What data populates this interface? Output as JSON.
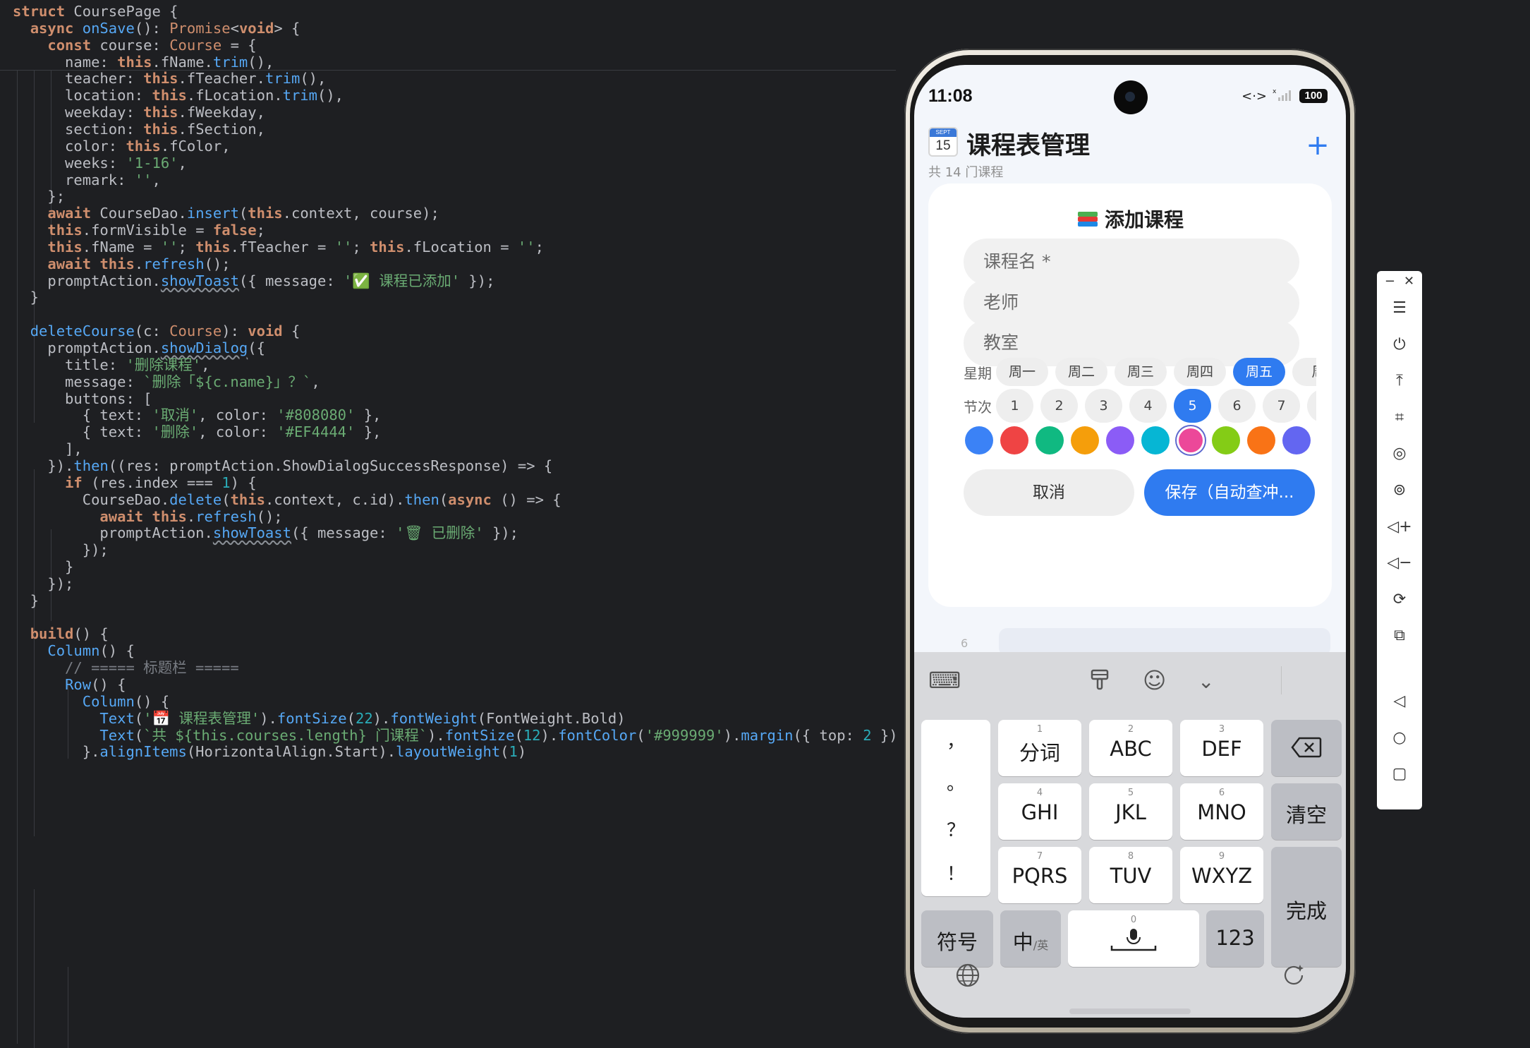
{
  "editor": {
    "lines": [
      "struct CoursePage {",
      "  async onSave(): Promise<void> {",
      "    const course: Course = {",
      "      name: this.fName.trim(),",
      "      teacher: this.fTeacher.trim(),",
      "      location: this.fLocation.trim(),",
      "      weekday: this.fWeekday,",
      "      section: this.fSection,",
      "      color: this.fColor,",
      "      weeks: '1-16',",
      "      remark: '',",
      "    };",
      "    await CourseDao.insert(this.context, course);",
      "    this.formVisible = false;",
      "    this.fName = ''; this.fTeacher = ''; this.fLocation = '';",
      "    await this.refresh();",
      "    promptAction.showToast({ message: '✅ 课程已添加' });",
      "  }",
      "",
      "  deleteCourse(c: Course): void {",
      "    promptAction.showDialog({",
      "      title: '删除课程',",
      "      message: `删除「${c.name}」？`,",
      "      buttons: [",
      "        { text: '取消', color: '#808080' },",
      "        { text: '删除', color: '#EF4444' },",
      "      ],",
      "    }).then((res: promptAction.ShowDialogSuccessResponse) => {",
      "      if (res.index === 1) {",
      "        CourseDao.delete(this.context, c.id).then(async () => {",
      "          await this.refresh();",
      "          promptAction.showToast({ message: '🗑 已删除' });",
      "        });",
      "      }",
      "    });",
      "  }",
      "",
      "  build() {",
      "    Column() {",
      "      // ===== 标题栏 =====",
      "      Row() {",
      "        Column() {",
      "          Text('📅 课程表管理').fontSize(22).fontWeight(FontWeight.Bold)",
      "          Text(`共 ${this.courses.length} 门课程`).fontSize(12).fontColor('#999999').margin({ top: 2 })",
      "        }.alignItems(HorizontalAlign.Start).layoutWeight(1)"
    ]
  },
  "phone": {
    "status": {
      "time": "11:08",
      "battery": "100",
      "net_icon": "<·>",
      "signal_icon": "signal-bars-icon"
    },
    "header": {
      "title": "课程表管理",
      "subtitle": "共 14 门课程",
      "calendar_month": "SEPT",
      "calendar_day": "15",
      "add_label": "+"
    },
    "form": {
      "title": "添加课程",
      "fields": [
        {
          "placeholder": "课程名 *"
        },
        {
          "placeholder": "老师"
        },
        {
          "placeholder": "教室"
        }
      ],
      "weekday_label": "星期",
      "weekdays": [
        "周一",
        "周二",
        "周三",
        "周四",
        "周五",
        "周"
      ],
      "weekday_selected": "周五",
      "section_label": "节次",
      "sections": [
        "1",
        "2",
        "3",
        "4",
        "5",
        "6",
        "7",
        ""
      ],
      "section_selected": "5",
      "colors": [
        "#3B82F6",
        "#EF4444",
        "#10B981",
        "#F59E0B",
        "#8B5CF6",
        "#06B6D4",
        "#EC4899",
        "#84CC16",
        "#F97316",
        "#6366F1"
      ],
      "color_selected": "#EC4899",
      "cancel_label": "取消",
      "save_label": "保存（自动查冲..."
    },
    "peek_number": "6",
    "keyboard": {
      "punct": [
        "，",
        "。",
        "？",
        "！"
      ],
      "keys": [
        {
          "num": "1",
          "label": "分词"
        },
        {
          "num": "2",
          "label": "ABC"
        },
        {
          "num": "3",
          "label": "DEF"
        },
        {
          "num": "4",
          "label": "GHI"
        },
        {
          "num": "5",
          "label": "JKL"
        },
        {
          "num": "6",
          "label": "MNO"
        },
        {
          "num": "7",
          "label": "PQRS"
        },
        {
          "num": "8",
          "label": "TUV"
        },
        {
          "num": "9",
          "label": "WXYZ"
        }
      ],
      "clear_label": "清空",
      "done_label": "完成",
      "symbol_label": "符号",
      "lang_label": "中",
      "lang_sub": "/英",
      "space_num": "0",
      "num_label": "123"
    }
  },
  "side_toolbar": {
    "icons": [
      "minimize-icon",
      "close-icon",
      "menu-icon",
      "power-icon",
      "pin-top-icon",
      "crop-icon",
      "record-icon",
      "screenshot-icon",
      "volume-up-icon",
      "volume-down-icon",
      "rotate-icon",
      "multi-device-icon",
      "back-icon",
      "home-icon",
      "recent-icon"
    ]
  }
}
